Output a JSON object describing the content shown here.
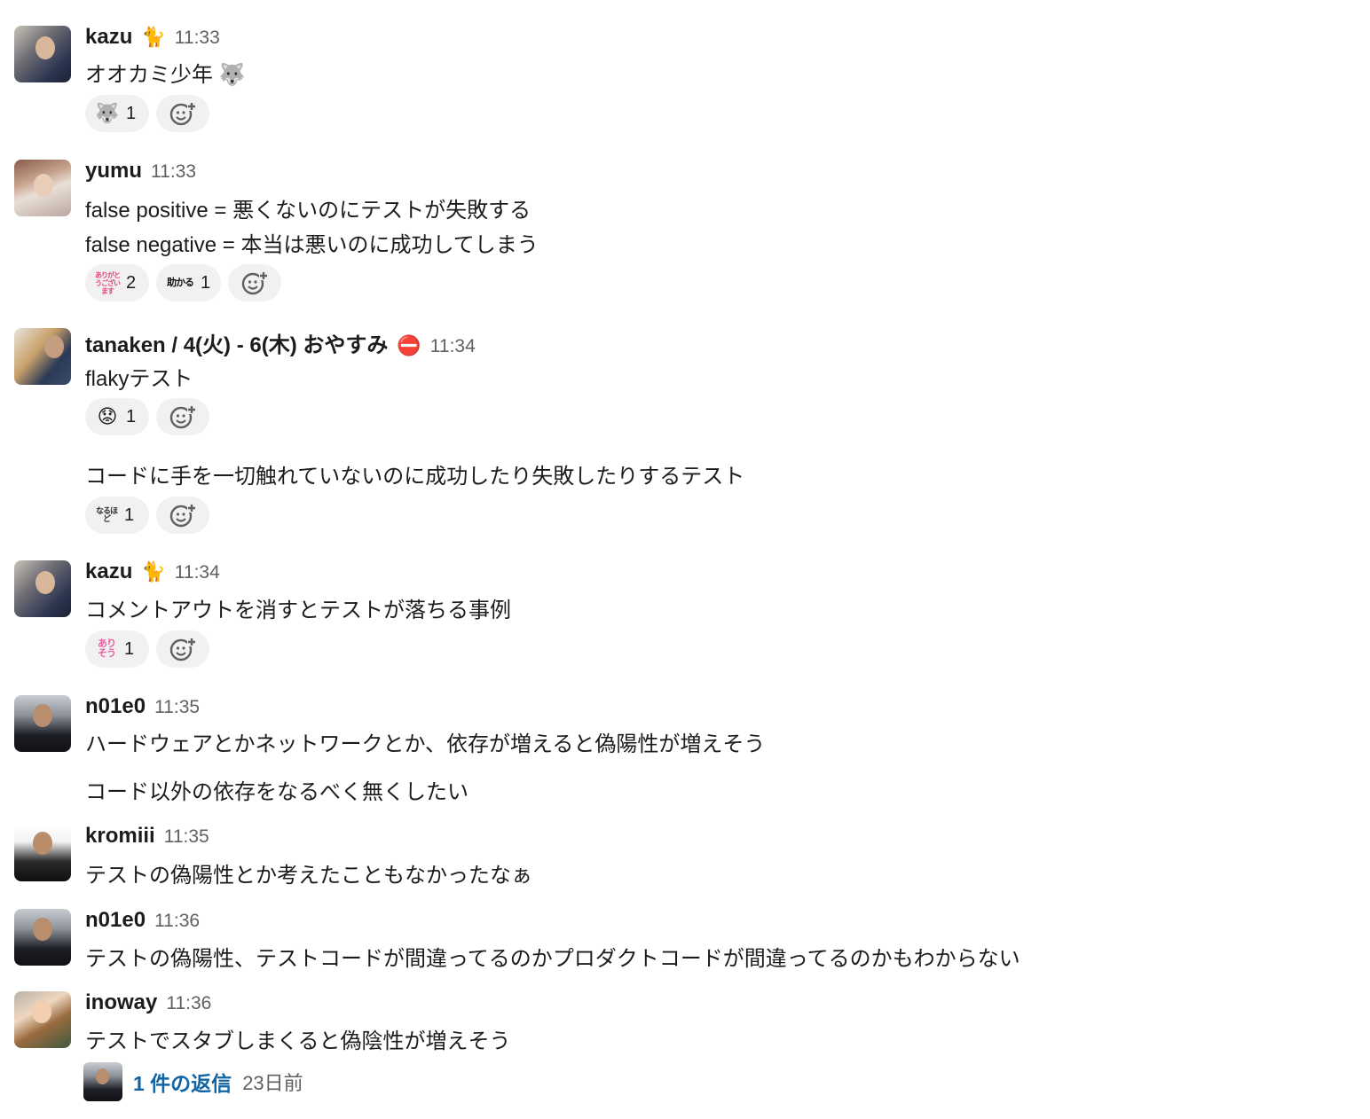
{
  "messages": [
    {
      "author": "kazu",
      "status": "🐈",
      "time": "11:33",
      "lines": [
        "オオカミ少年 🐺"
      ],
      "reactions": [
        {
          "emoji": "🐺",
          "count": "1"
        }
      ]
    },
    {
      "author": "yumu",
      "time": "11:33",
      "lines": [
        "false positive = 悪くないのにテストが失敗する",
        "false negative = 本当は悪いのに成功してしまう"
      ],
      "reactions": [
        {
          "emoji": "ありがとうございます",
          "count": "2"
        },
        {
          "emoji": "助かる",
          "count": "1"
        }
      ]
    },
    {
      "author": "tanaken / 4(火) - 6(木) おやすみ",
      "status": "⛔",
      "time": "11:34",
      "lines": [
        "flakyテスト"
      ],
      "reactions": [
        {
          "emoji": "😟",
          "count": "1"
        }
      ],
      "followup": {
        "text": "コードに手を一切触れていないのに成功したり失敗したりするテスト",
        "reactions": [
          {
            "emoji": "なるほど",
            "count": "1"
          }
        ]
      }
    },
    {
      "author": "kazu",
      "status": "🐈",
      "time": "11:34",
      "lines": [
        "コメントアウトを消すとテストが落ちる事例"
      ],
      "reactions": [
        {
          "emoji": "ありそう",
          "count": "1"
        }
      ]
    },
    {
      "author": "n01e0",
      "time": "11:35",
      "lines": [
        "ハードウェアとかネットワークとか、依存が増えると偽陽性が増えそう",
        "コード以外の依存をなるべく無くしたい"
      ]
    },
    {
      "author": "kromiii",
      "time": "11:35",
      "lines": [
        "テストの偽陽性とか考えたこともなかったなぁ"
      ]
    },
    {
      "author": "n01e0",
      "time": "11:36",
      "lines": [
        "テストの偽陽性、テストコードが間違ってるのかプロダクトコードが間違ってるのかもわからない"
      ]
    },
    {
      "author": "inoway",
      "time": "11:36",
      "lines": [
        "テストでスタブしまくると偽陰性が増えそう"
      ]
    }
  ],
  "thread": {
    "replies": "1 件の返信",
    "age": "23日前"
  },
  "icons": {
    "add_reaction": "add-reaction-icon",
    "status_cat": "cat-icon",
    "status_dnd": "no-entry-icon"
  }
}
